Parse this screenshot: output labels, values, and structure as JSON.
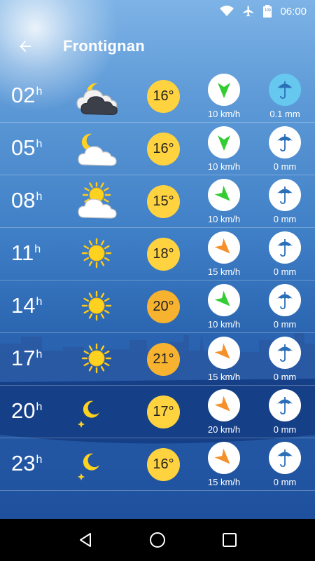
{
  "status_bar": {
    "time": "06:00",
    "battery": "100"
  },
  "header": {
    "title": "Frontignan"
  },
  "units": {
    "hour_suffix": "h"
  },
  "colors": {
    "temp_yellow": "#ffd23f",
    "temp_orange": "#f7b230",
    "wind_green": "#33cc33",
    "wind_orange": "#f5902a",
    "rain_wet": "#66c8ee"
  },
  "forecast": [
    {
      "hour": "02",
      "icon": "cloudy-night-icon",
      "temp": "16°",
      "wind": "10 km/h",
      "wind_color": "green",
      "wind_dir": 180,
      "rain": "0.1 mm",
      "rain_wet": true,
      "temp_tone": "yellow"
    },
    {
      "hour": "05",
      "icon": "partly-cloudy-night-icon",
      "temp": "16°",
      "wind": "10 km/h",
      "wind_color": "green",
      "wind_dir": 180,
      "rain": "0 mm",
      "rain_wet": false,
      "temp_tone": "yellow"
    },
    {
      "hour": "08",
      "icon": "partly-sunny-icon",
      "temp": "15°",
      "wind": "10 km/h",
      "wind_color": "green",
      "wind_dir": 135,
      "rain": "0 mm",
      "rain_wet": false,
      "temp_tone": "yellow"
    },
    {
      "hour": "11",
      "icon": "sun-icon",
      "temp": "18°",
      "wind": "15 km/h",
      "wind_color": "orange",
      "wind_dir": 135,
      "rain": "0 mm",
      "rain_wet": false,
      "temp_tone": "yellow"
    },
    {
      "hour": "14",
      "icon": "sun-icon",
      "temp": "20°",
      "wind": "10 km/h",
      "wind_color": "green",
      "wind_dir": 135,
      "rain": "0 mm",
      "rain_wet": false,
      "temp_tone": "orange"
    },
    {
      "hour": "17",
      "icon": "sun-icon",
      "temp": "21°",
      "wind": "15 km/h",
      "wind_color": "orange",
      "wind_dir": 135,
      "rain": "0 mm",
      "rain_wet": false,
      "temp_tone": "orange"
    },
    {
      "hour": "20",
      "icon": "moon-icon",
      "temp": "17°",
      "wind": "20 km/h",
      "wind_color": "orange",
      "wind_dir": 135,
      "rain": "0 mm",
      "rain_wet": false,
      "temp_tone": "yellow"
    },
    {
      "hour": "23",
      "icon": "moon-icon",
      "temp": "16°",
      "wind": "15 km/h",
      "wind_color": "orange",
      "wind_dir": 135,
      "rain": "0 mm",
      "rain_wet": false,
      "temp_tone": "yellow"
    }
  ]
}
